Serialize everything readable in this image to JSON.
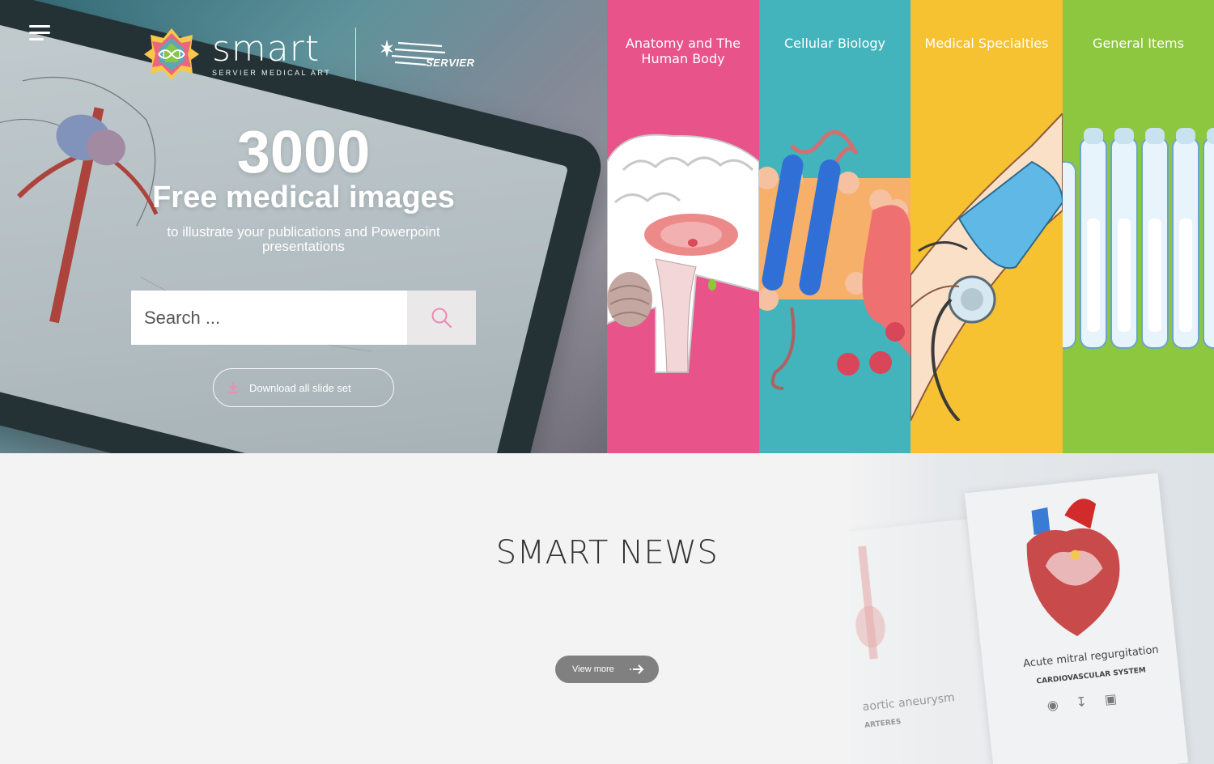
{
  "header": {
    "menu_icon": "hamburger-menu-icon",
    "logo": {
      "name": "smart",
      "tagline": "SERVIER MEDICAL ART",
      "partner": "SERVIER"
    }
  },
  "hero": {
    "count": "3000",
    "title": "Free medical images",
    "subtitle": "to illustrate your publications and Powerpoint presentations",
    "search_placeholder": "Search ...",
    "search_icon": "search-icon",
    "download_label": "Download all slide set",
    "download_icon": "download-icon"
  },
  "categories": [
    {
      "label": "Anatomy and The Human Body",
      "color": "#e8538a"
    },
    {
      "label": "Cellular Biology",
      "color": "#43b3bc"
    },
    {
      "label": "Medical Specialties",
      "color": "#f6c232"
    },
    {
      "label": "General Items",
      "color": "#8dc63f"
    }
  ],
  "news": {
    "title": "SMART NEWS",
    "view_more": "View more",
    "view_more_icon": "arrow-right-icon",
    "cards": [
      {
        "caption": "Acute mitral regurgitation",
        "category": "CARDIOVASCULAR SYSTEM"
      },
      {
        "caption": "aortic aneurysm",
        "category": "ARTERES"
      }
    ]
  }
}
